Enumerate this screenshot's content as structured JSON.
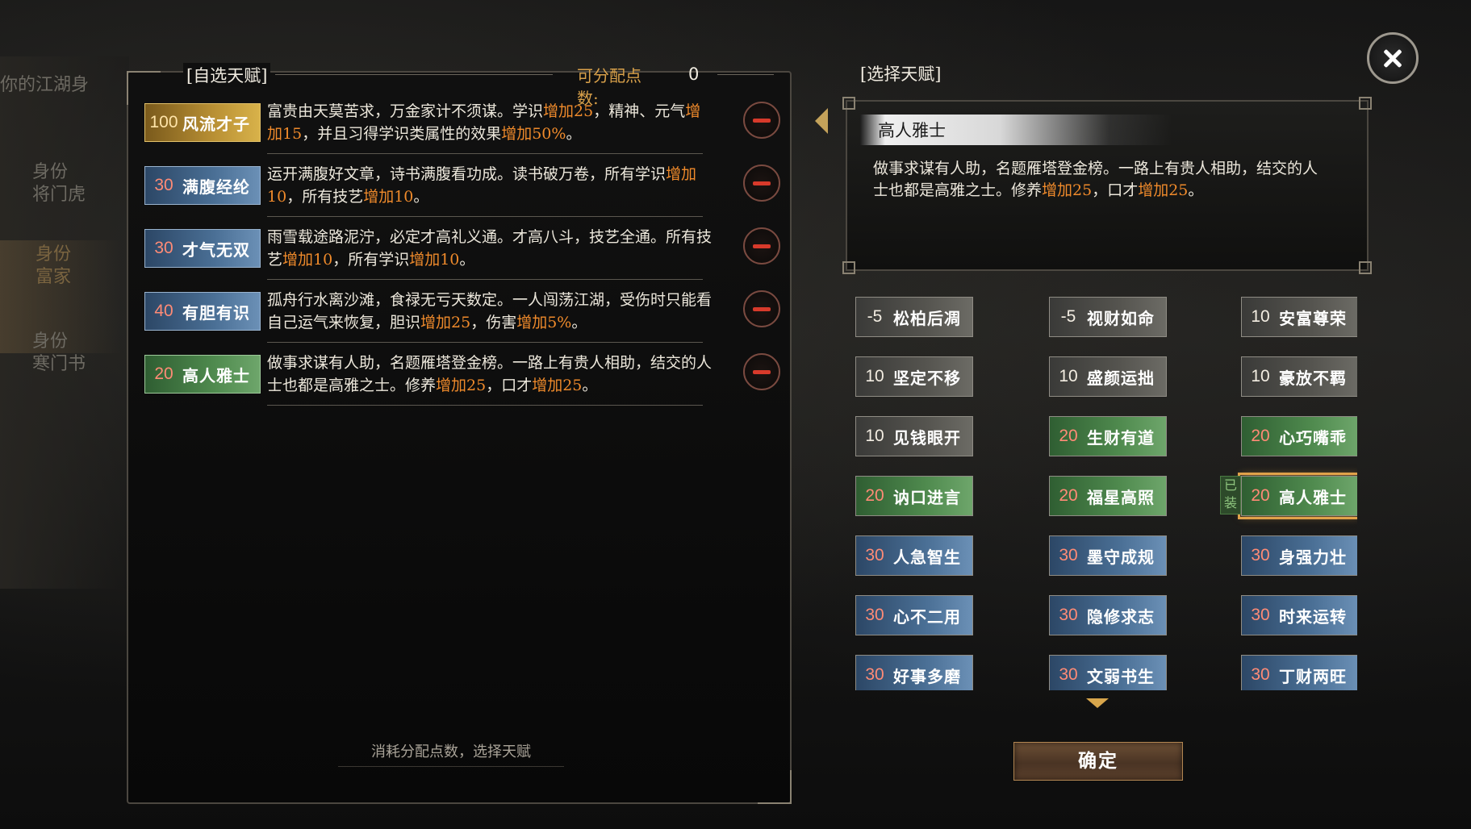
{
  "background": {
    "fragments": [
      "你的江湖身",
      "身份",
      "将门虎",
      "身份",
      "富家",
      "身份",
      "寒门书"
    ]
  },
  "left_panel": {
    "title": "[自选天赋]",
    "points_label": "可分配点数:",
    "points_value": "0",
    "footer": "消耗分配点数，选择天赋",
    "items": [
      {
        "cost": "100",
        "name": "风流才子",
        "rarity": "gold",
        "desc": [
          [
            "富贵由天莫苦求，万金家计不须谋。学识",
            "n"
          ],
          [
            "增加25",
            "o"
          ],
          [
            "，精神、元气",
            "n"
          ],
          [
            "增加15",
            "o"
          ],
          [
            "，并且习得学识类属性的效果",
            "n"
          ],
          [
            "增加50%",
            "o"
          ],
          [
            "。",
            "n"
          ]
        ]
      },
      {
        "cost": "30",
        "name": "满腹经纶",
        "rarity": "blue",
        "desc": [
          [
            "运开满腹好文章，诗书满腹看功成。读书破万卷，所有学识",
            "n"
          ],
          [
            "增加10",
            "o"
          ],
          [
            "，所有技艺",
            "n"
          ],
          [
            "增加10",
            "o"
          ],
          [
            "。",
            "n"
          ]
        ]
      },
      {
        "cost": "30",
        "name": "才气无双",
        "rarity": "blue",
        "desc": [
          [
            "雨雪载途路泥泞，必定才高礼义通。才高八斗，技艺全通。所有技艺",
            "n"
          ],
          [
            "增加10",
            "o"
          ],
          [
            "，所有学识",
            "n"
          ],
          [
            "增加10",
            "o"
          ],
          [
            "。",
            "n"
          ]
        ]
      },
      {
        "cost": "40",
        "name": "有胆有识",
        "rarity": "blue",
        "desc": [
          [
            "孤舟行水离沙滩，食禄无亏天数定。一人闯荡江湖，受伤时只能看自己运气来恢复，胆识",
            "n"
          ],
          [
            "增加25",
            "o"
          ],
          [
            "，伤害",
            "n"
          ],
          [
            "增加5%",
            "o"
          ],
          [
            "。",
            "n"
          ]
        ]
      },
      {
        "cost": "20",
        "name": "高人雅士",
        "rarity": "green",
        "desc": [
          [
            "做事求谋有人助，名题雁塔登金榜。一路上有贵人相助，结交的人士也都是高雅之士。修养",
            "n"
          ],
          [
            "增加25",
            "o"
          ],
          [
            "，口才",
            "n"
          ],
          [
            "增加25",
            "o"
          ],
          [
            "。",
            "n"
          ]
        ]
      }
    ]
  },
  "right_panel": {
    "title": "[选择天赋]",
    "detail": {
      "name": "高人雅士",
      "desc": [
        [
          "做事求谋有人助，名题雁塔登金榜。一路上有贵人相助，结交的人士也都是高雅之士。修养",
          "n"
        ],
        [
          "增加25",
          "o"
        ],
        [
          "，口才",
          "n"
        ],
        [
          "增加25",
          "o"
        ],
        [
          "。",
          "n"
        ]
      ]
    },
    "equipped_label": "已装",
    "confirm_label": "确定",
    "talents": [
      {
        "cost": "-5",
        "name": "松柏后凋",
        "rarity": "gray"
      },
      {
        "cost": "-5",
        "name": "视财如命",
        "rarity": "gray"
      },
      {
        "cost": "10",
        "name": "安富尊荣",
        "rarity": "gray"
      },
      {
        "cost": "10",
        "name": "坚定不移",
        "rarity": "gray"
      },
      {
        "cost": "10",
        "name": "盛颜运拙",
        "rarity": "gray"
      },
      {
        "cost": "10",
        "name": "豪放不羁",
        "rarity": "gray"
      },
      {
        "cost": "10",
        "name": "见钱眼开",
        "rarity": "gray"
      },
      {
        "cost": "20",
        "name": "生财有道",
        "rarity": "green"
      },
      {
        "cost": "20",
        "name": "心巧嘴乖",
        "rarity": "green"
      },
      {
        "cost": "20",
        "name": "讷口进言",
        "rarity": "green"
      },
      {
        "cost": "20",
        "name": "福星高照",
        "rarity": "green"
      },
      {
        "cost": "20",
        "name": "高人雅士",
        "rarity": "green",
        "selected": true
      },
      {
        "cost": "30",
        "name": "人急智生",
        "rarity": "blue"
      },
      {
        "cost": "30",
        "name": "墨守成规",
        "rarity": "blue"
      },
      {
        "cost": "30",
        "name": "身强力壮",
        "rarity": "blue"
      },
      {
        "cost": "30",
        "name": "心不二用",
        "rarity": "blue"
      },
      {
        "cost": "30",
        "name": "隐修求志",
        "rarity": "blue"
      },
      {
        "cost": "30",
        "name": "时来运转",
        "rarity": "blue"
      },
      {
        "cost": "30",
        "name": "好事多磨",
        "rarity": "blue"
      },
      {
        "cost": "30",
        "name": "文弱书生",
        "rarity": "blue"
      },
      {
        "cost": "30",
        "name": "丁财两旺",
        "rarity": "blue"
      }
    ]
  },
  "colors": {
    "highlight": "#ef8a2b",
    "gold": "#b99034",
    "green": "#4f8a4e",
    "blue": "#4a6f95",
    "gray": "#55544f",
    "selected": "#e0a24a"
  }
}
